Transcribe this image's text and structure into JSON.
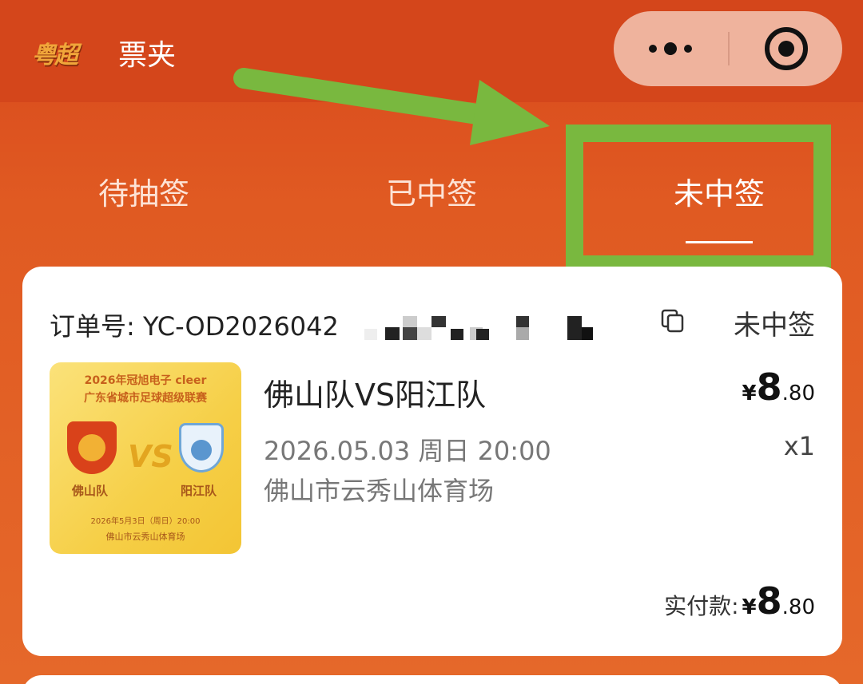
{
  "header": {
    "logo_text": "粤超",
    "title": "票夹"
  },
  "tabs": [
    {
      "label": "待抽签",
      "active": false
    },
    {
      "label": "已中签",
      "active": false
    },
    {
      "label": "未中签",
      "active": true
    }
  ],
  "order": {
    "number_label": "订单号: YC-OD2026042",
    "status": "未中签",
    "match_title": "佛山队VS阳江队",
    "datetime": "2026.05.03 周日 20:00",
    "venue": "佛山市云秀山体育场",
    "price_currency": "¥",
    "price_int": "8",
    "price_dec": ".80",
    "quantity": "x1",
    "paid_label": "实付款:",
    "paid_currency": "¥",
    "paid_int": "8",
    "paid_dec": ".80",
    "poster": {
      "title_line1": "2026年冠旭电子 cleer",
      "title_line2": "广东省城市足球超级联赛",
      "vs_text": "VS",
      "team_left": "佛山队",
      "team_right": "阳江队",
      "date": "2026年5月3日（周日）20:00",
      "venue": "佛山市云秀山体育场"
    }
  },
  "colors": {
    "brand_orange": "#d4461b",
    "annotation_green": "#79b83f"
  },
  "icons": {
    "more": "more-dots-icon",
    "close": "target-circle-icon",
    "copy": "copy-icon"
  }
}
